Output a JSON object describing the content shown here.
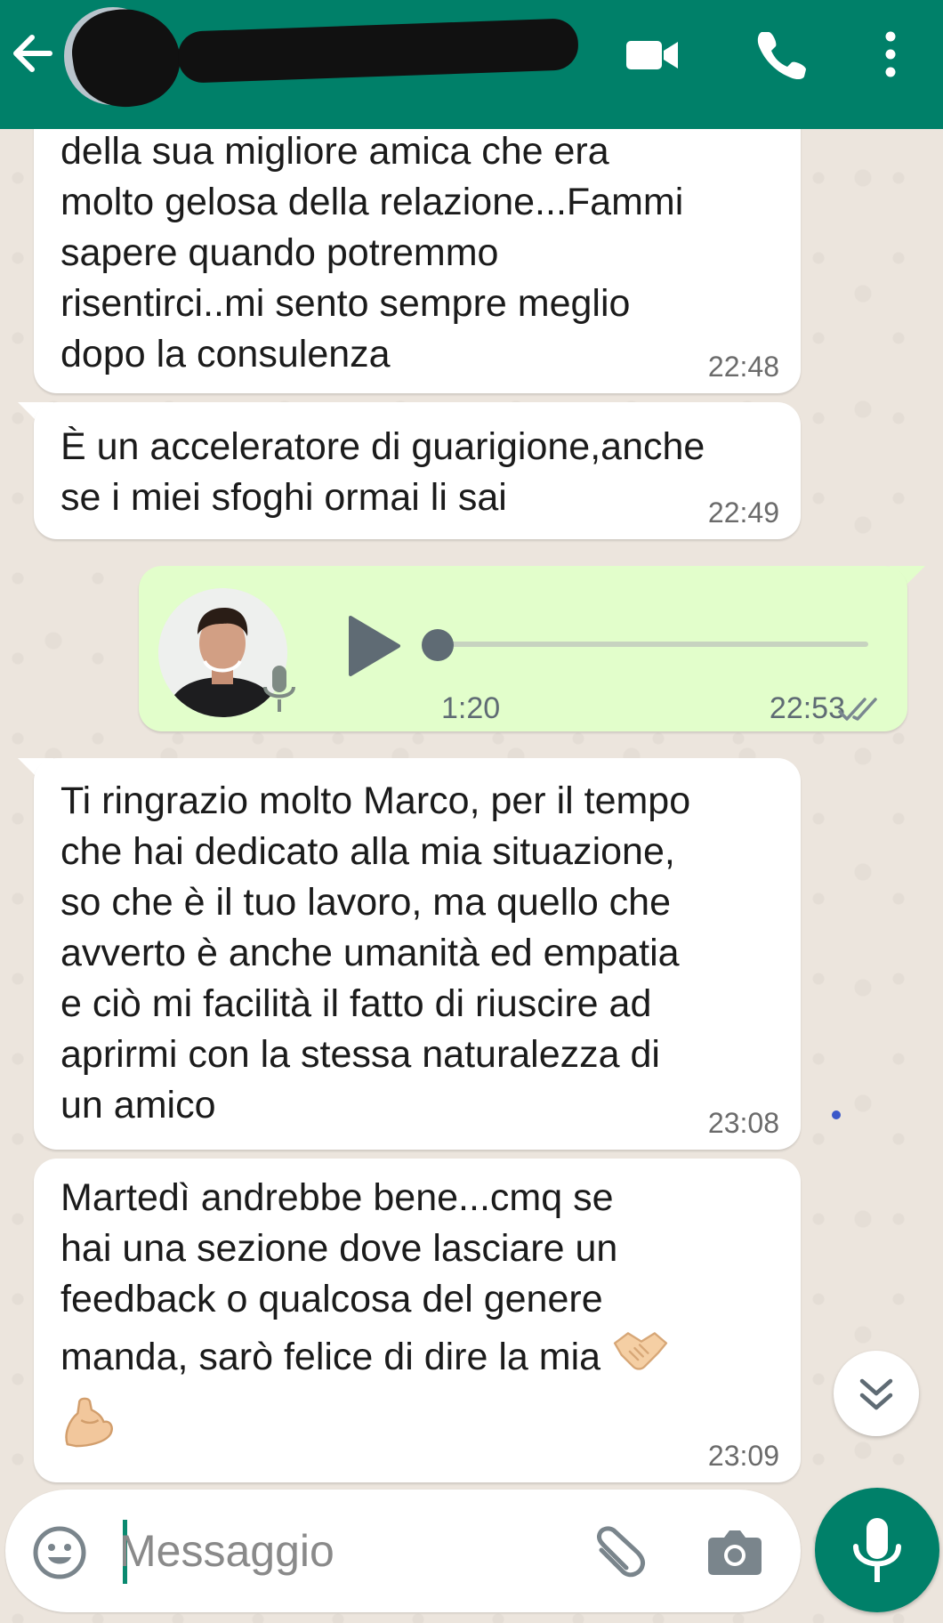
{
  "header": {
    "contact_name": "",
    "icons": [
      "back-arrow-icon",
      "video-call-icon",
      "voice-call-icon",
      "more-options-icon"
    ]
  },
  "messages": [
    {
      "direction": "in",
      "text": "della sua migliore amica che era\nmolto gelosa della relazione...Fammi\nsapere quando potremmo\nrisentirci..mi sento sempre meglio\ndopo la consulenza",
      "time": "22:48"
    },
    {
      "direction": "in",
      "text": "È un acceleratore di guarigione,anche\nse i miei sfoghi ormai li sai",
      "time": "22:49"
    },
    {
      "direction": "out",
      "type": "voice",
      "duration": "1:20",
      "time": "22:53",
      "status": "read",
      "progress": 0
    },
    {
      "direction": "in",
      "text": "Ti ringrazio molto Marco, per il tempo\nche hai dedicato alla mia situazione,\nso che è il tuo lavoro, ma quello che\navverto è anche umanità ed empatia\ne ciò mi facilità il fatto di riuscire ad\naprirmi con la stessa naturalezza di\nun amico",
      "time": "23:08"
    },
    {
      "direction": "in",
      "text_lines": [
        "Martedì andrebbe bene...cmq se",
        "hai una sezione dove lasciare un",
        "feedback o qualcosa del genere",
        "manda, sarò felice di dire la mia"
      ],
      "emojis": [
        "handshake",
        "flexed-biceps"
      ],
      "time": "23:09"
    }
  ],
  "composer": {
    "placeholder": "Messaggio",
    "value": ""
  },
  "colors": {
    "header": "#008069",
    "outgoing_bubble": "#e2fecb",
    "incoming_bubble": "#ffffff",
    "wallpaper": "#ece5dd"
  }
}
